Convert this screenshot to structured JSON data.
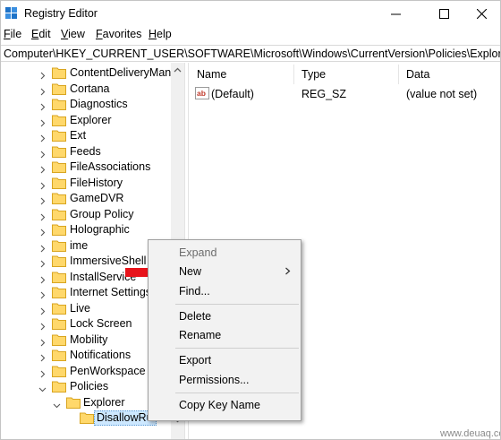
{
  "window": {
    "title": "Registry Editor"
  },
  "menu": [
    {
      "label": "File",
      "key": "F",
      "rest": "ile"
    },
    {
      "label": "Edit",
      "key": "E",
      "rest": "dit"
    },
    {
      "label": "View",
      "key": "V",
      "rest": "iew"
    },
    {
      "label": "Favorites",
      "key": "F",
      "rest": "avorites"
    },
    {
      "label": "Help",
      "key": "H",
      "rest": "elp"
    }
  ],
  "address": "Computer\\HKEY_CURRENT_USER\\SOFTWARE\\Microsoft\\Windows\\CurrentVersion\\Policies\\Explorer\\DisallowRun",
  "tree": {
    "items": [
      {
        "label": "ContentDeliveryManager",
        "display": "ContentDeliveryMana"
      },
      {
        "label": "Cortana",
        "display": "Cortana"
      },
      {
        "label": "Diagnostics",
        "display": "Diagnostics"
      },
      {
        "label": "Explorer",
        "display": "Explorer"
      },
      {
        "label": "Ext",
        "display": "Ext"
      },
      {
        "label": "Feeds",
        "display": "Feeds"
      },
      {
        "label": "FileAssociations",
        "display": "FileAssociations"
      },
      {
        "label": "FileHistory",
        "display": "FileHistory"
      },
      {
        "label": "GameDVR",
        "display": "GameDVR"
      },
      {
        "label": "Group Policy",
        "display": "Group Policy"
      },
      {
        "label": "Holographic",
        "display": "Holographic"
      },
      {
        "label": "ime",
        "display": "ime"
      },
      {
        "label": "ImmersiveShell",
        "display": "ImmersiveShell"
      },
      {
        "label": "InstallService",
        "display": "InstallService"
      },
      {
        "label": "Internet Settings",
        "display": "Internet Settings"
      },
      {
        "label": "Live",
        "display": "Live"
      },
      {
        "label": "Lock Screen",
        "display": "Lock Screen"
      },
      {
        "label": "Mobility",
        "display": "Mobility"
      },
      {
        "label": "Notifications",
        "display": "Notifications"
      },
      {
        "label": "PenWorkspace",
        "display": "PenWorkspace"
      },
      {
        "label": "Policies",
        "display": "Policies"
      }
    ],
    "policies_child": "Explorer",
    "selected_child": "DisallowRun"
  },
  "values_pane": {
    "columns": [
      "Name",
      "Type",
      "Data"
    ],
    "rows": [
      {
        "name": "(Default)",
        "type": "REG_SZ",
        "data": "(value not set)"
      }
    ]
  },
  "context_menu": {
    "expand": "Expand",
    "new": "New",
    "find": "Find...",
    "delete": "Delete",
    "rename": "Rename",
    "export": "Export",
    "permissions": "Permissions...",
    "copy_key_name": "Copy Key Name"
  },
  "watermark": "www.deuaq.com",
  "colors": {
    "selection": "#cde8ff",
    "folder": "#ffd86b",
    "arrow": "#e8141b"
  }
}
